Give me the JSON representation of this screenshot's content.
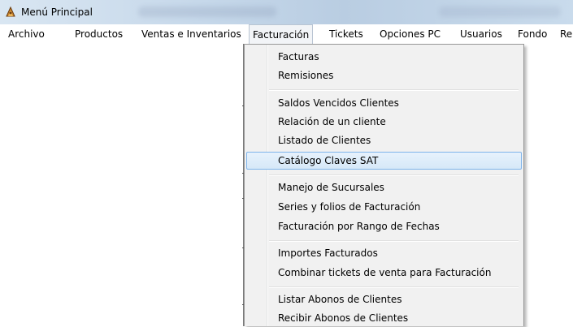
{
  "window": {
    "title": "Menú Principal"
  },
  "menubar": {
    "items": [
      {
        "label": "Archivo"
      },
      {
        "label": "Productos"
      },
      {
        "label": "Ventas e Inventarios"
      },
      {
        "label": "Facturación"
      },
      {
        "label": "Tickets"
      },
      {
        "label": "Opciones PC"
      },
      {
        "label": "Usuarios"
      },
      {
        "label": "Fondo"
      },
      {
        "label": "Re"
      }
    ],
    "open_item": "Facturación"
  },
  "dropdown": {
    "items": [
      {
        "label": "Facturas"
      },
      {
        "label": "Remisiones"
      },
      {
        "label": "Saldos Vencidos Clientes"
      },
      {
        "label": "Relación de un cliente"
      },
      {
        "label": "Listado de Clientes"
      },
      {
        "label": "Catálogo Claves SAT",
        "highlighted": true
      },
      {
        "label": "Manejo de Sucursales"
      },
      {
        "label": "Series y folios de Facturación"
      },
      {
        "label": "Facturación por Rango de Fechas"
      },
      {
        "label": "Importes Facturados"
      },
      {
        "label": "Combinar tickets de venta para Facturación"
      },
      {
        "label": "Listar Abonos de Clientes"
      },
      {
        "label": "Recibir Abonos de Clientes"
      }
    ]
  },
  "colors": {
    "highlight_border": "#7eb4ea",
    "menu_background": "#f1f1f1",
    "titlebar": "#c6d8ea"
  }
}
